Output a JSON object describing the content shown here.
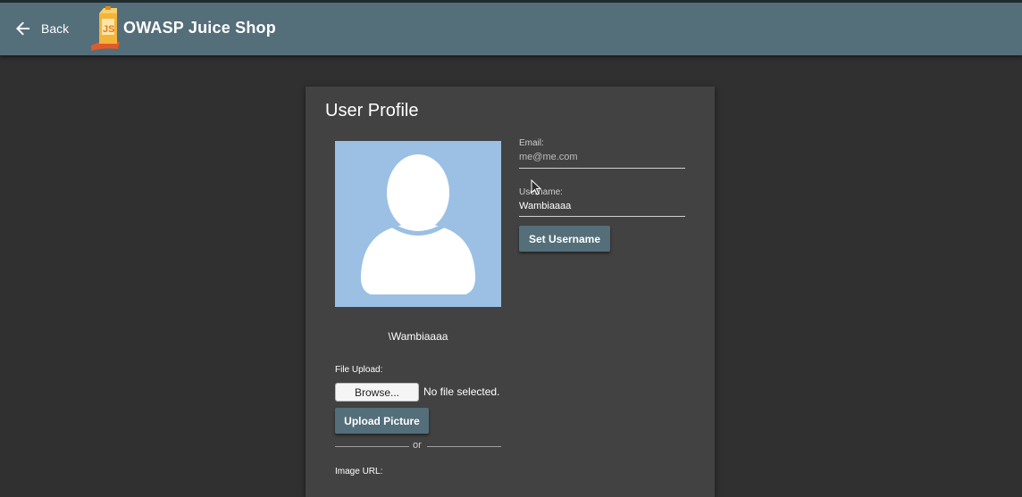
{
  "header": {
    "back_label": "Back",
    "app_title": "OWASP Juice Shop",
    "bar_color": "#546e7a"
  },
  "profile": {
    "title": "User Profile",
    "avatar_name": "\\Wambiaaaa",
    "email": {
      "label": "Email:",
      "value": "me@me.com"
    },
    "username": {
      "label": "Username:",
      "value": "Wambiaaaa"
    },
    "set_username_label": "Set Username",
    "file_upload": {
      "label": "File Upload:",
      "browse_label": "Browse...",
      "status": "No file selected."
    },
    "upload_picture_label": "Upload Picture",
    "or_label": "or",
    "image_url_label": "Image URL:"
  },
  "icons": {
    "back": "arrow-left-icon",
    "logo": "juice-shop-logo-icon",
    "avatar": "user-silhouette-icon",
    "cursor": "mouse-pointer-icon"
  }
}
